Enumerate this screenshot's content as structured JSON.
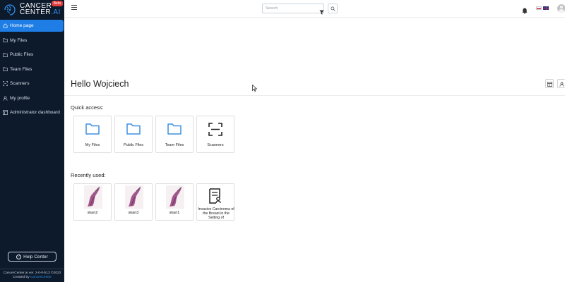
{
  "sidebar": {
    "brand": {
      "line1": "CANCER",
      "line2a": "CENTER",
      "line2b": ".AI",
      "badge": "Beta"
    },
    "items": [
      {
        "label": "Home page",
        "icon": "home-icon",
        "active": true
      },
      {
        "label": "My Files",
        "icon": "folder-icon",
        "active": false
      },
      {
        "label": "Public Files",
        "icon": "folder-icon",
        "active": false
      },
      {
        "label": "Team Files",
        "icon": "folder-icon",
        "active": false
      },
      {
        "label": "Scanners",
        "icon": "scanner-icon",
        "active": false
      },
      {
        "label": "My profile",
        "icon": "user-icon",
        "active": false
      },
      {
        "label": "Administrator dashboard",
        "icon": "dashboard-icon",
        "active": false
      }
    ],
    "help_label": "Help Center",
    "footer_line1": "CancerCenter.ai ver. 2-0-0-b13 ©2023",
    "footer_created": "Created by",
    "footer_link": "CancerCenter"
  },
  "topbar": {
    "search_placeholder": "Search"
  },
  "main": {
    "greeting": "Hello Wojciech",
    "quick_access_title": "Quick access:",
    "quick_access": [
      {
        "label": "My Files",
        "icon": "folder-icon"
      },
      {
        "label": "Public Files",
        "icon": "folder-icon"
      },
      {
        "label": "Team Files",
        "icon": "folder-icon"
      },
      {
        "label": "Scanners",
        "icon": "scanner-icon"
      }
    ],
    "recently_used_title": "Recently used:",
    "recent": [
      {
        "label": "skan2",
        "kind": "thumbnail"
      },
      {
        "label": "skan3",
        "kind": "thumbnail"
      },
      {
        "label": "skan1",
        "kind": "thumbnail"
      },
      {
        "label": "Invasive Carcinoma of the Breast in the Setting of",
        "kind": "document"
      }
    ]
  },
  "colors": {
    "sidebar_bg": "#0c1a2c",
    "accent": "#1e7ee6",
    "folder": "#3d8fe0"
  }
}
